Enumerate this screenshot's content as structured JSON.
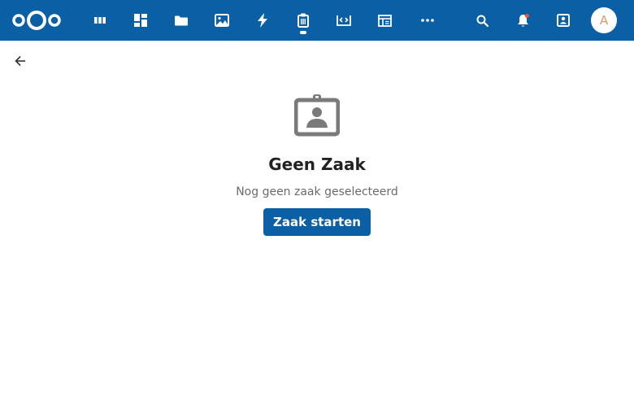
{
  "header": {
    "apps": [
      {
        "name": "deck",
        "icon": "deck-icon"
      },
      {
        "name": "dashboard",
        "icon": "dashboard-icon"
      },
      {
        "name": "files",
        "icon": "folder-icon"
      },
      {
        "name": "photos",
        "icon": "image-icon"
      },
      {
        "name": "activity",
        "icon": "lightning-icon"
      },
      {
        "name": "cases",
        "icon": "clipboard-icon",
        "active": true
      },
      {
        "name": "code",
        "icon": "code-icon"
      },
      {
        "name": "tables",
        "icon": "table-icon"
      },
      {
        "name": "more",
        "icon": "more-icon"
      }
    ],
    "right": [
      "search-icon",
      "notifications-icon",
      "contacts-icon"
    ],
    "avatar_initial": "A"
  },
  "main": {
    "back_icon": "arrow-left-icon",
    "empty_state": {
      "icon": "id-badge-icon",
      "title": "Geen Zaak",
      "description": "Nog geen zaak geselecteerd",
      "button_label": "Zaak starten"
    }
  },
  "colors": {
    "header_bg": "#0b5fa5",
    "primary": "#0b5fa5",
    "notification_dot": "#e9572b",
    "avatar_text": "#d49a72",
    "empty_icon": "#7a7a7a"
  }
}
